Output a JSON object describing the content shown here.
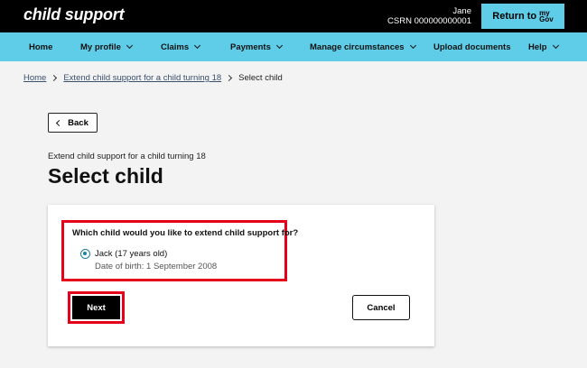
{
  "header": {
    "brand": "child support",
    "user_name": "Jane",
    "csrn": "CSRN 000000000001",
    "return_label": "Return to",
    "mygov_top": "my",
    "mygov_bottom": "Gov"
  },
  "nav": {
    "items": [
      {
        "label": "Home",
        "has_menu": false
      },
      {
        "label": "My profile",
        "has_menu": true
      },
      {
        "label": "Claims",
        "has_menu": true
      },
      {
        "label": "Payments",
        "has_menu": true
      },
      {
        "label": "Manage circumstances",
        "has_menu": true
      },
      {
        "label": "Upload documents",
        "has_menu": false
      },
      {
        "label": "Help",
        "has_menu": true
      }
    ]
  },
  "breadcrumb": {
    "home": "Home",
    "parent": "Extend child support for a child turning 18",
    "current": "Select child"
  },
  "back_label": "Back",
  "page": {
    "subtitle": "Extend child support for a child turning 18",
    "title": "Select child"
  },
  "form": {
    "question": "Which child would you like to extend child support for?",
    "options": [
      {
        "name": "Jack (17 years old)",
        "detail": "Date of birth: 1 September 2008",
        "selected": true
      }
    ],
    "next_label": "Next",
    "cancel_label": "Cancel"
  },
  "colors": {
    "accent": "#5fcde8",
    "highlight": "#e4001b",
    "radio": "#1e7fa0"
  }
}
